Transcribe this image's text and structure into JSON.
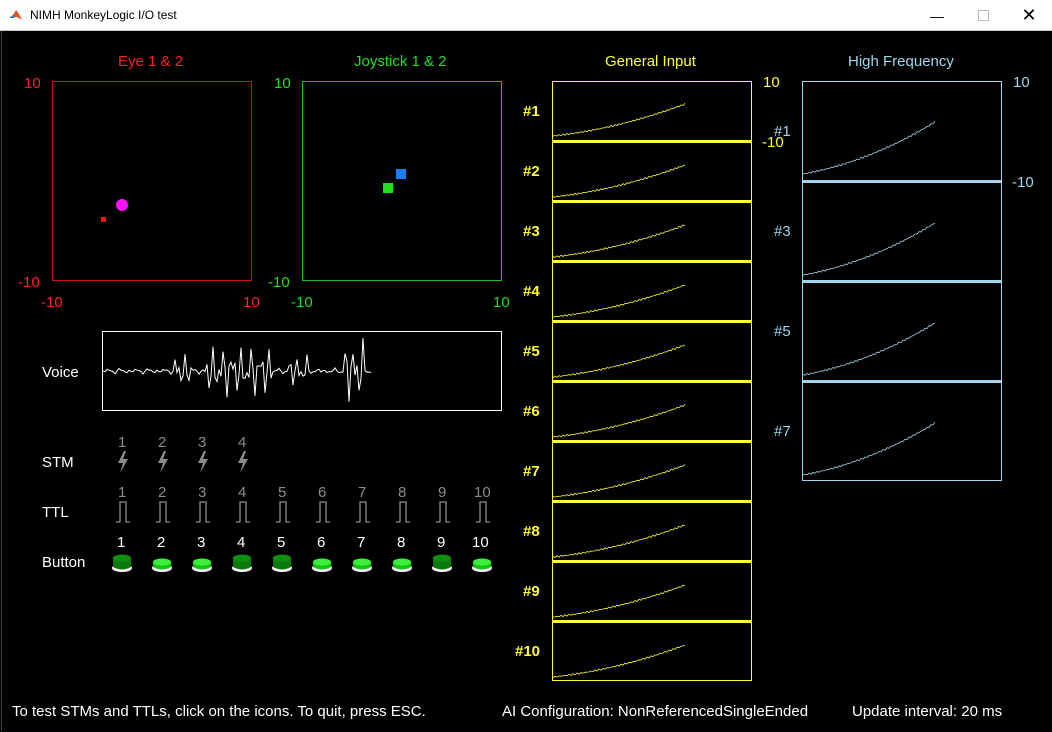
{
  "window": {
    "title": "NIMH MonkeyLogic I/O test"
  },
  "colors": {
    "eye": "#ff2020",
    "joystick": "#22dd22",
    "general": "#ffff33",
    "high_freq": "#9fd6ea",
    "eye_point_1": "#ff10ff",
    "eye_point_2": "#ff1010",
    "joy_point_1": "#1a7fff",
    "joy_point_2": "#20e020"
  },
  "eye": {
    "title": "Eye 1 & 2",
    "ymax": "10",
    "ymin": "-10",
    "xmin": "-10",
    "xmax": "10"
  },
  "joystick": {
    "title": "Joystick 1 & 2",
    "ymax": "10",
    "ymin": "-10",
    "xmin": "-10",
    "xmax": "10"
  },
  "general": {
    "title": "General Input",
    "ymax": "10",
    "ymin": "-10",
    "channels": [
      "#1",
      "#2",
      "#3",
      "#4",
      "#5",
      "#6",
      "#7",
      "#8",
      "#9",
      "#10"
    ]
  },
  "high_freq": {
    "title": "High Frequency",
    "ymax": "10",
    "ymin": "-10",
    "channels": [
      "#1",
      "#3",
      "#5",
      "#7"
    ]
  },
  "voice": {
    "label": "Voice"
  },
  "stm": {
    "label": "STM",
    "items": [
      "1",
      "2",
      "3",
      "4"
    ],
    "icon": "lightning-icon"
  },
  "ttl": {
    "label": "TTL",
    "items": [
      "1",
      "2",
      "3",
      "4",
      "5",
      "6",
      "7",
      "8",
      "9",
      "10"
    ],
    "icon": "pulse-icon"
  },
  "button": {
    "label": "Button",
    "items": [
      "1",
      "2",
      "3",
      "4",
      "5",
      "6",
      "7",
      "8",
      "9",
      "10"
    ],
    "pressed": [
      true,
      false,
      false,
      true,
      true,
      false,
      false,
      false,
      true,
      false
    ]
  },
  "footer": {
    "hint": "To test STMs and TTLs, click on the icons. To quit, press ESC.",
    "ai_config": "AI Configuration: NonReferencedSingleEnded",
    "update_interval": "Update interval: 20 ms"
  }
}
